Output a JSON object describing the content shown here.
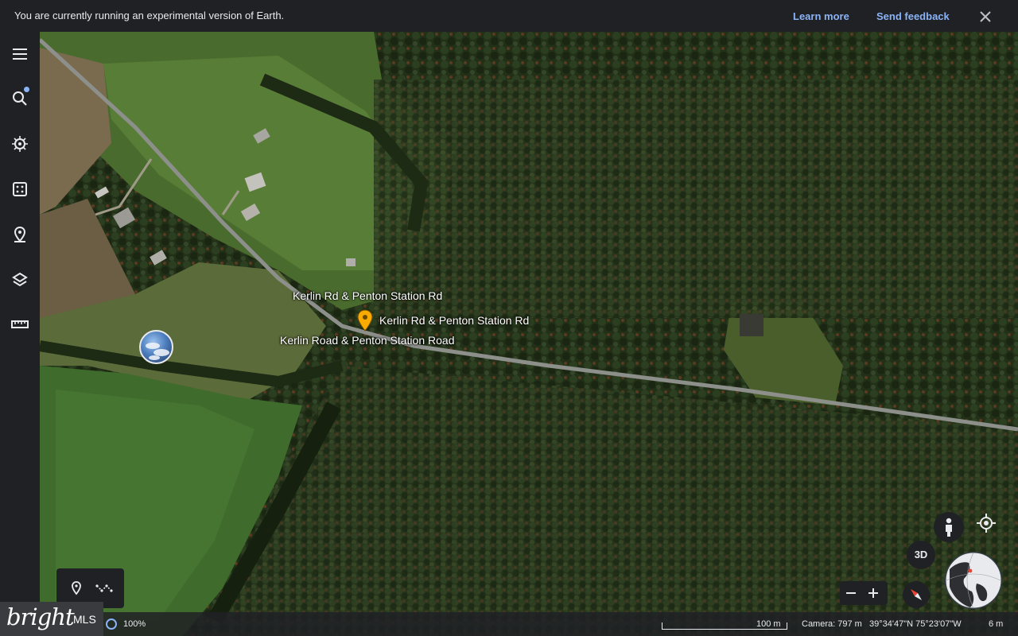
{
  "banner": {
    "message": "You are currently running an experimental version of Earth.",
    "learn_more": "Learn more",
    "send_feedback": "Send feedback",
    "close_icon": "close-icon"
  },
  "rail": {
    "items": [
      {
        "name": "menu",
        "icon": "menu-icon"
      },
      {
        "name": "search",
        "icon": "search-icon"
      },
      {
        "name": "voyager",
        "icon": "voyager-icon"
      },
      {
        "name": "feeling-lucky",
        "icon": "dice-icon"
      },
      {
        "name": "projects",
        "icon": "map-pin-icon"
      },
      {
        "name": "map-style",
        "icon": "layers-icon"
      },
      {
        "name": "measure",
        "icon": "ruler-icon"
      }
    ]
  },
  "map": {
    "labels": [
      "Kerlin Rd & Penton Station Rd",
      "Kerlin Rd & Penton Station Rd",
      "Kerlin Road & Penton Station Road"
    ]
  },
  "tools": {
    "placemark_icon": "placemark-icon",
    "path_icon": "path-icon"
  },
  "status": {
    "loading_percent": "100%",
    "scale": "100 m",
    "camera": "Camera: 797 m",
    "coordinates": "39°34'47\"N 75°23'07\"W",
    "altitude": "6 m"
  },
  "brand": {
    "name": "bright",
    "suffix": "MLS"
  },
  "controls": {
    "three_d": "3D"
  },
  "colors": {
    "accent": "#8ab4f8",
    "pin": "#f9ab00",
    "chrome": "#202124"
  }
}
